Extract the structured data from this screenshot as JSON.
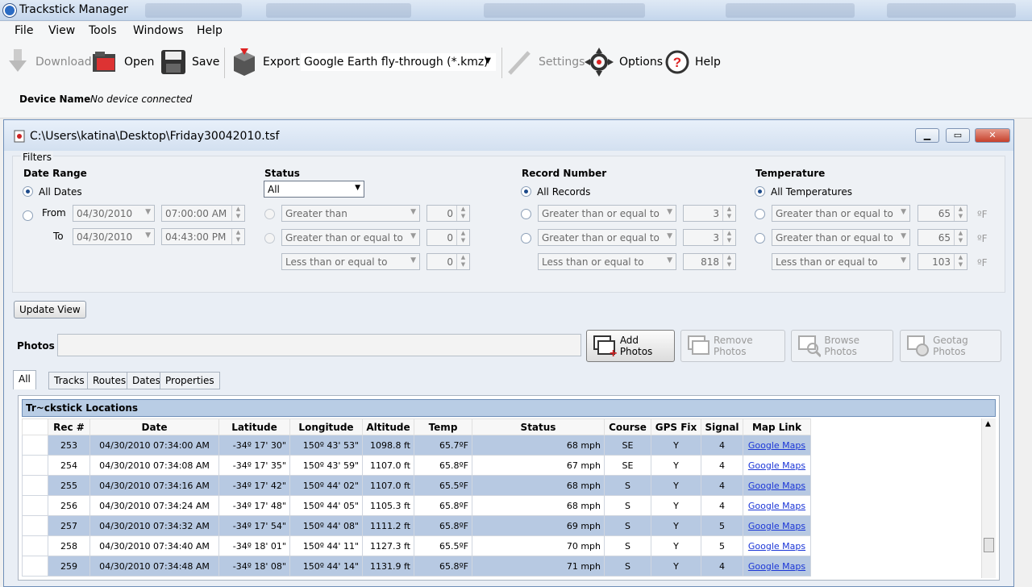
{
  "window": {
    "title": "Trackstick Manager"
  },
  "menu": [
    "File",
    "View",
    "Tools",
    "Windows",
    "Help"
  ],
  "toolbar": {
    "download": "Download",
    "open": "Open",
    "save": "Save",
    "export": "Export",
    "export_format": "Google Earth fly-through (*.kmz)",
    "settings": "Settings",
    "options": "Options",
    "help": "Help"
  },
  "device": {
    "label": "Device Name",
    "value": "No device connected"
  },
  "document": {
    "title": "C:\\Users\\katina\\Desktop\\Friday30042010.tsf"
  },
  "filters": {
    "group_label": "Filters",
    "date_range": {
      "heading": "Date Range",
      "all_label": "All Dates",
      "from_label": "From",
      "to_label": "To",
      "from_date": "04/30/2010",
      "from_time": "07:00:00 AM",
      "to_date": "04/30/2010",
      "to_time": "04:43:00 PM"
    },
    "status": {
      "heading": "Status",
      "select": "All",
      "row1_op": "Greater than",
      "row1_val": "0",
      "row2_op": "Greater than or equal to",
      "row2_val": "0",
      "row3_op": "Less than or equal to",
      "row3_val": "0"
    },
    "record": {
      "heading": "Record Number",
      "all_label": "All Records",
      "row1_op": "Greater than or equal to",
      "row1_val": "3",
      "row2_op": "Greater than or equal to",
      "row2_val": "3",
      "row3_op": "Less than or equal to",
      "row3_val": "818"
    },
    "temperature": {
      "heading": "Temperature",
      "all_label": "All Temperatures",
      "unit": "ºF",
      "row1_op": "Greater than or equal to",
      "row1_val": "65",
      "row2_op": "Greater than or equal to",
      "row2_val": "65",
      "row3_op": "Less than or equal to",
      "row3_val": "103"
    }
  },
  "update_view": "Update View",
  "photos": {
    "label": "Photos",
    "add": "Add Photos",
    "remove": "Remove Photos",
    "browse": "Browse Photos",
    "geotag": "Geotag Photos"
  },
  "tabs": [
    "All",
    "Tracks",
    "Routes",
    "Dates",
    "Properties"
  ],
  "grid": {
    "title": "Tr~ckstick Locations",
    "columns": [
      "Rec #",
      "Date",
      "Latitude",
      "Longitude",
      "Altitude",
      "Temp",
      "Status",
      "Course",
      "GPS Fix",
      "Signal",
      "Map Link"
    ],
    "rows": [
      [
        "253",
        "04/30/2010 07:34:00 AM",
        "-34º 17' 30\"",
        "150º 43' 53\"",
        "1098.8 ft",
        "65.7ºF",
        "68 mph",
        "SE",
        "Y",
        "4",
        "Google Maps"
      ],
      [
        "254",
        "04/30/2010 07:34:08 AM",
        "-34º 17' 35\"",
        "150º 43' 59\"",
        "1107.0 ft",
        "65.8ºF",
        "67 mph",
        "SE",
        "Y",
        "4",
        "Google Maps"
      ],
      [
        "255",
        "04/30/2010 07:34:16 AM",
        "-34º 17' 42\"",
        "150º 44' 02\"",
        "1107.0 ft",
        "65.5ºF",
        "68 mph",
        "S",
        "Y",
        "4",
        "Google Maps"
      ],
      [
        "256",
        "04/30/2010 07:34:24 AM",
        "-34º 17' 48\"",
        "150º 44' 05\"",
        "1105.3 ft",
        "65.8ºF",
        "68 mph",
        "S",
        "Y",
        "4",
        "Google Maps"
      ],
      [
        "257",
        "04/30/2010 07:34:32 AM",
        "-34º 17' 54\"",
        "150º 44' 08\"",
        "1111.2 ft",
        "65.8ºF",
        "69 mph",
        "S",
        "Y",
        "5",
        "Google Maps"
      ],
      [
        "258",
        "04/30/2010 07:34:40 AM",
        "-34º 18' 01\"",
        "150º 44' 11\"",
        "1127.3 ft",
        "65.5ºF",
        "70 mph",
        "S",
        "Y",
        "5",
        "Google Maps"
      ],
      [
        "259",
        "04/30/2010 07:34:48 AM",
        "-34º 18' 08\"",
        "150º 44' 14\"",
        "1131.9 ft",
        "65.8ºF",
        "71 mph",
        "S",
        "Y",
        "4",
        "Google Maps"
      ]
    ]
  }
}
